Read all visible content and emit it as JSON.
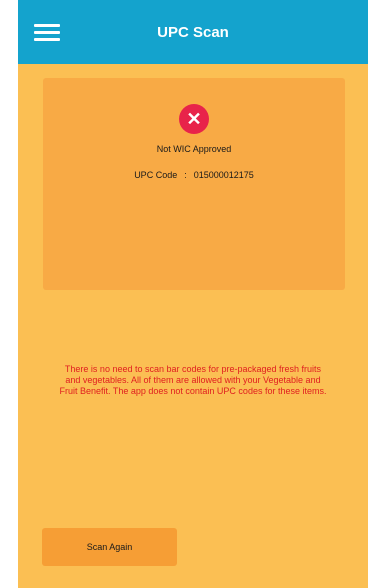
{
  "header": {
    "title": "UPC Scan",
    "menu_icon": "hamburger-menu-icon"
  },
  "result": {
    "status_icon": "close-circle-icon",
    "status_icon_glyph": "✕",
    "status_text": "Not WIC Approved",
    "upc_label": "UPC Code",
    "upc_separator": ":",
    "upc_value": "015000012175"
  },
  "notice": "There is no need to scan bar codes for pre-packaged fresh fruits and vegetables. All of them are allowed with your Vegetable and Fruit Benefit. The app does not contain UPC codes for these items.",
  "actions": {
    "scan_again_label": "Scan Again"
  },
  "colors": {
    "header": "#14A3CD",
    "background": "#FBBF53",
    "card": "#F8AA45",
    "error": "#E8234A",
    "notice_text": "#E02020",
    "button": "#F69E35"
  }
}
